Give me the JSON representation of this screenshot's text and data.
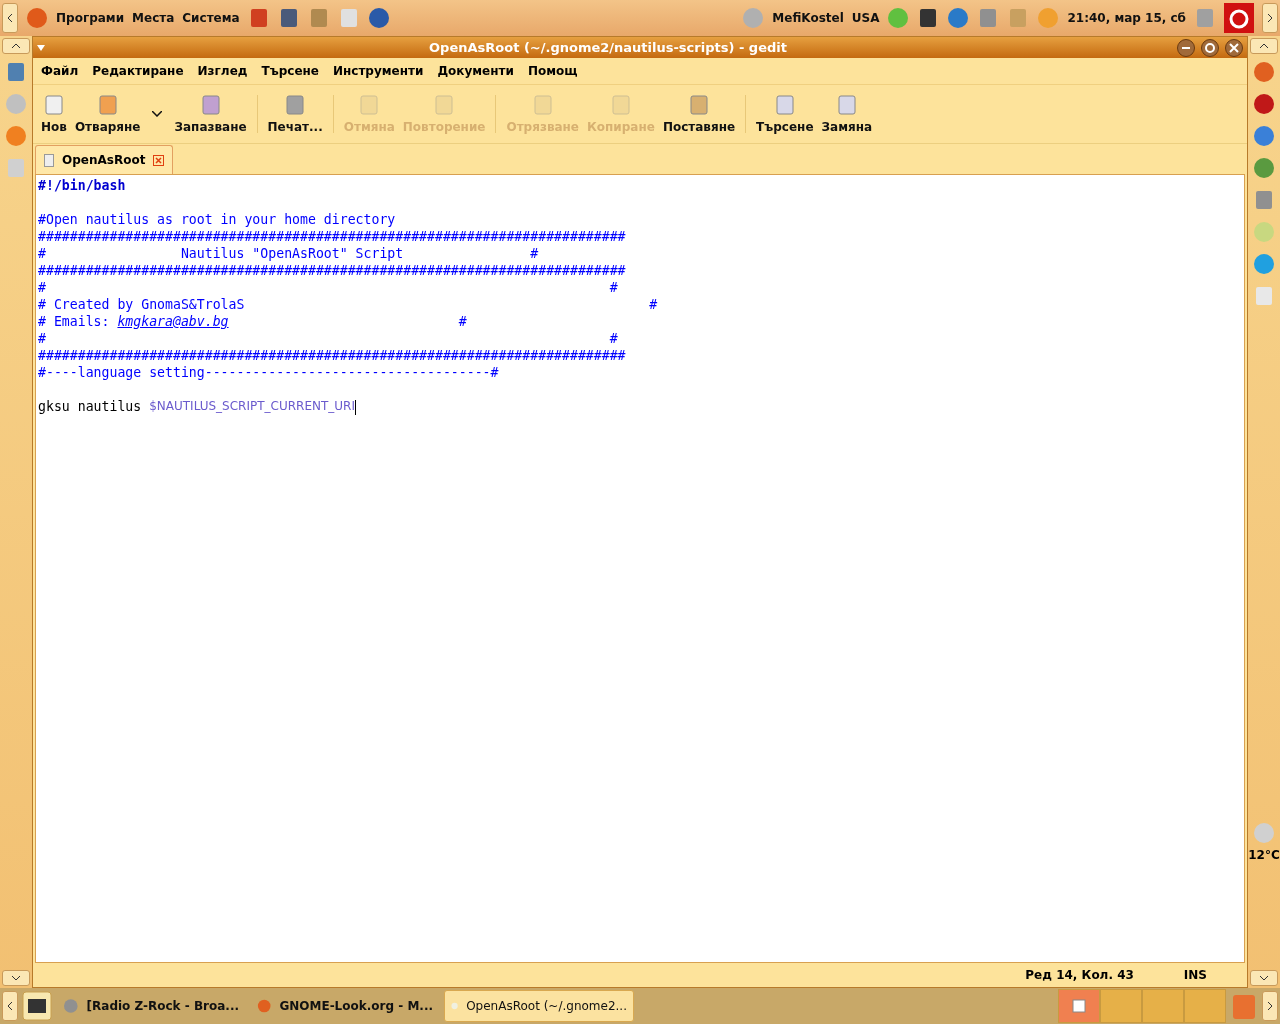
{
  "top_panel": {
    "menus": [
      "Програми",
      "Места",
      "Система"
    ],
    "user": "MefiKostel",
    "keyboard": "USA",
    "clock": "21:40, мар 15, сб"
  },
  "window": {
    "title": "OpenAsRoot (~/.gnome2/nautilus-scripts) - gedit"
  },
  "menubar": [
    "Файл",
    "Редактиране",
    "Изглед",
    "Търсене",
    "Инструменти",
    "Документи",
    "Помощ"
  ],
  "toolbar": [
    {
      "label": "Нов",
      "disabled": false
    },
    {
      "label": "Отваряне",
      "disabled": false
    },
    {
      "label": "Запазване",
      "disabled": false
    },
    {
      "label": "Печат...",
      "disabled": false
    },
    {
      "label": "Отмяна",
      "disabled": true
    },
    {
      "label": "Повторение",
      "disabled": true
    },
    {
      "label": "Отрязване",
      "disabled": true
    },
    {
      "label": "Копиране",
      "disabled": true
    },
    {
      "label": "Поставяне",
      "disabled": false
    },
    {
      "label": "Търсене",
      "disabled": false
    },
    {
      "label": "Замяна",
      "disabled": false
    }
  ],
  "tabs": [
    {
      "label": "OpenAsRoot",
      "selected": true
    }
  ],
  "editor": {
    "lines": [
      {
        "segments": [
          {
            "kind": "shebang",
            "text": "#!/bin/bash"
          }
        ]
      },
      {
        "blank_line_before": true,
        "segments": [
          {
            "kind": "comment",
            "text": "#Open nautilus as root in your home directory"
          }
        ]
      },
      {
        "segments": [
          {
            "kind": "comment",
            "text": "##########################################################################"
          }
        ]
      },
      {
        "segments": [
          {
            "kind": "comment",
            "text": "#                 Nautilus \"OpenAsRoot\" Script                #"
          }
        ]
      },
      {
        "segments": [
          {
            "kind": "comment",
            "text": "##########################################################################"
          }
        ]
      },
      {
        "segments": [
          {
            "kind": "comment",
            "text": "#                                                                       #"
          }
        ]
      },
      {
        "segments": [
          {
            "kind": "comment",
            "text": "# Created by GnomaS&TrolaS                                                   #"
          }
        ]
      },
      {
        "segments": [
          {
            "kind": "comment",
            "text": "# Emails: "
          },
          {
            "kind": "link",
            "text": "kmgkara@abv.bg"
          },
          {
            "kind": "comment",
            "text": "                             #"
          }
        ]
      },
      {
        "segments": [
          {
            "kind": "comment",
            "text": "#                                                                       #"
          }
        ]
      },
      {
        "segments": [
          {
            "kind": "comment",
            "text": "##########################################################################"
          }
        ]
      },
      {
        "segments": [
          {
            "kind": "comment",
            "text": "#----language setting------------------------------------#"
          }
        ]
      },
      {
        "blank_line_before": true,
        "segments": [
          {
            "kind": "plain",
            "text": "gksu nautilus "
          },
          {
            "kind": "variable",
            "text": "$NAUTILUS_SCRIPT_CURRENT_URI"
          }
        ]
      }
    ]
  },
  "status_bar": {
    "position": "Ред 14, Кол. 43",
    "mode": "INS"
  },
  "taskbar": [
    {
      "label": "[Radio Z-Rock - Broa...",
      "selected": false
    },
    {
      "label": "GNOME-Look.org - M...",
      "selected": false
    },
    {
      "label": "OpenAsRoot (~/.gnome2...",
      "selected": true
    }
  ],
  "workspaces": [
    {
      "selected": true
    },
    {
      "selected": false
    },
    {
      "selected": false
    },
    {
      "selected": false
    }
  ],
  "weather": "12°C"
}
